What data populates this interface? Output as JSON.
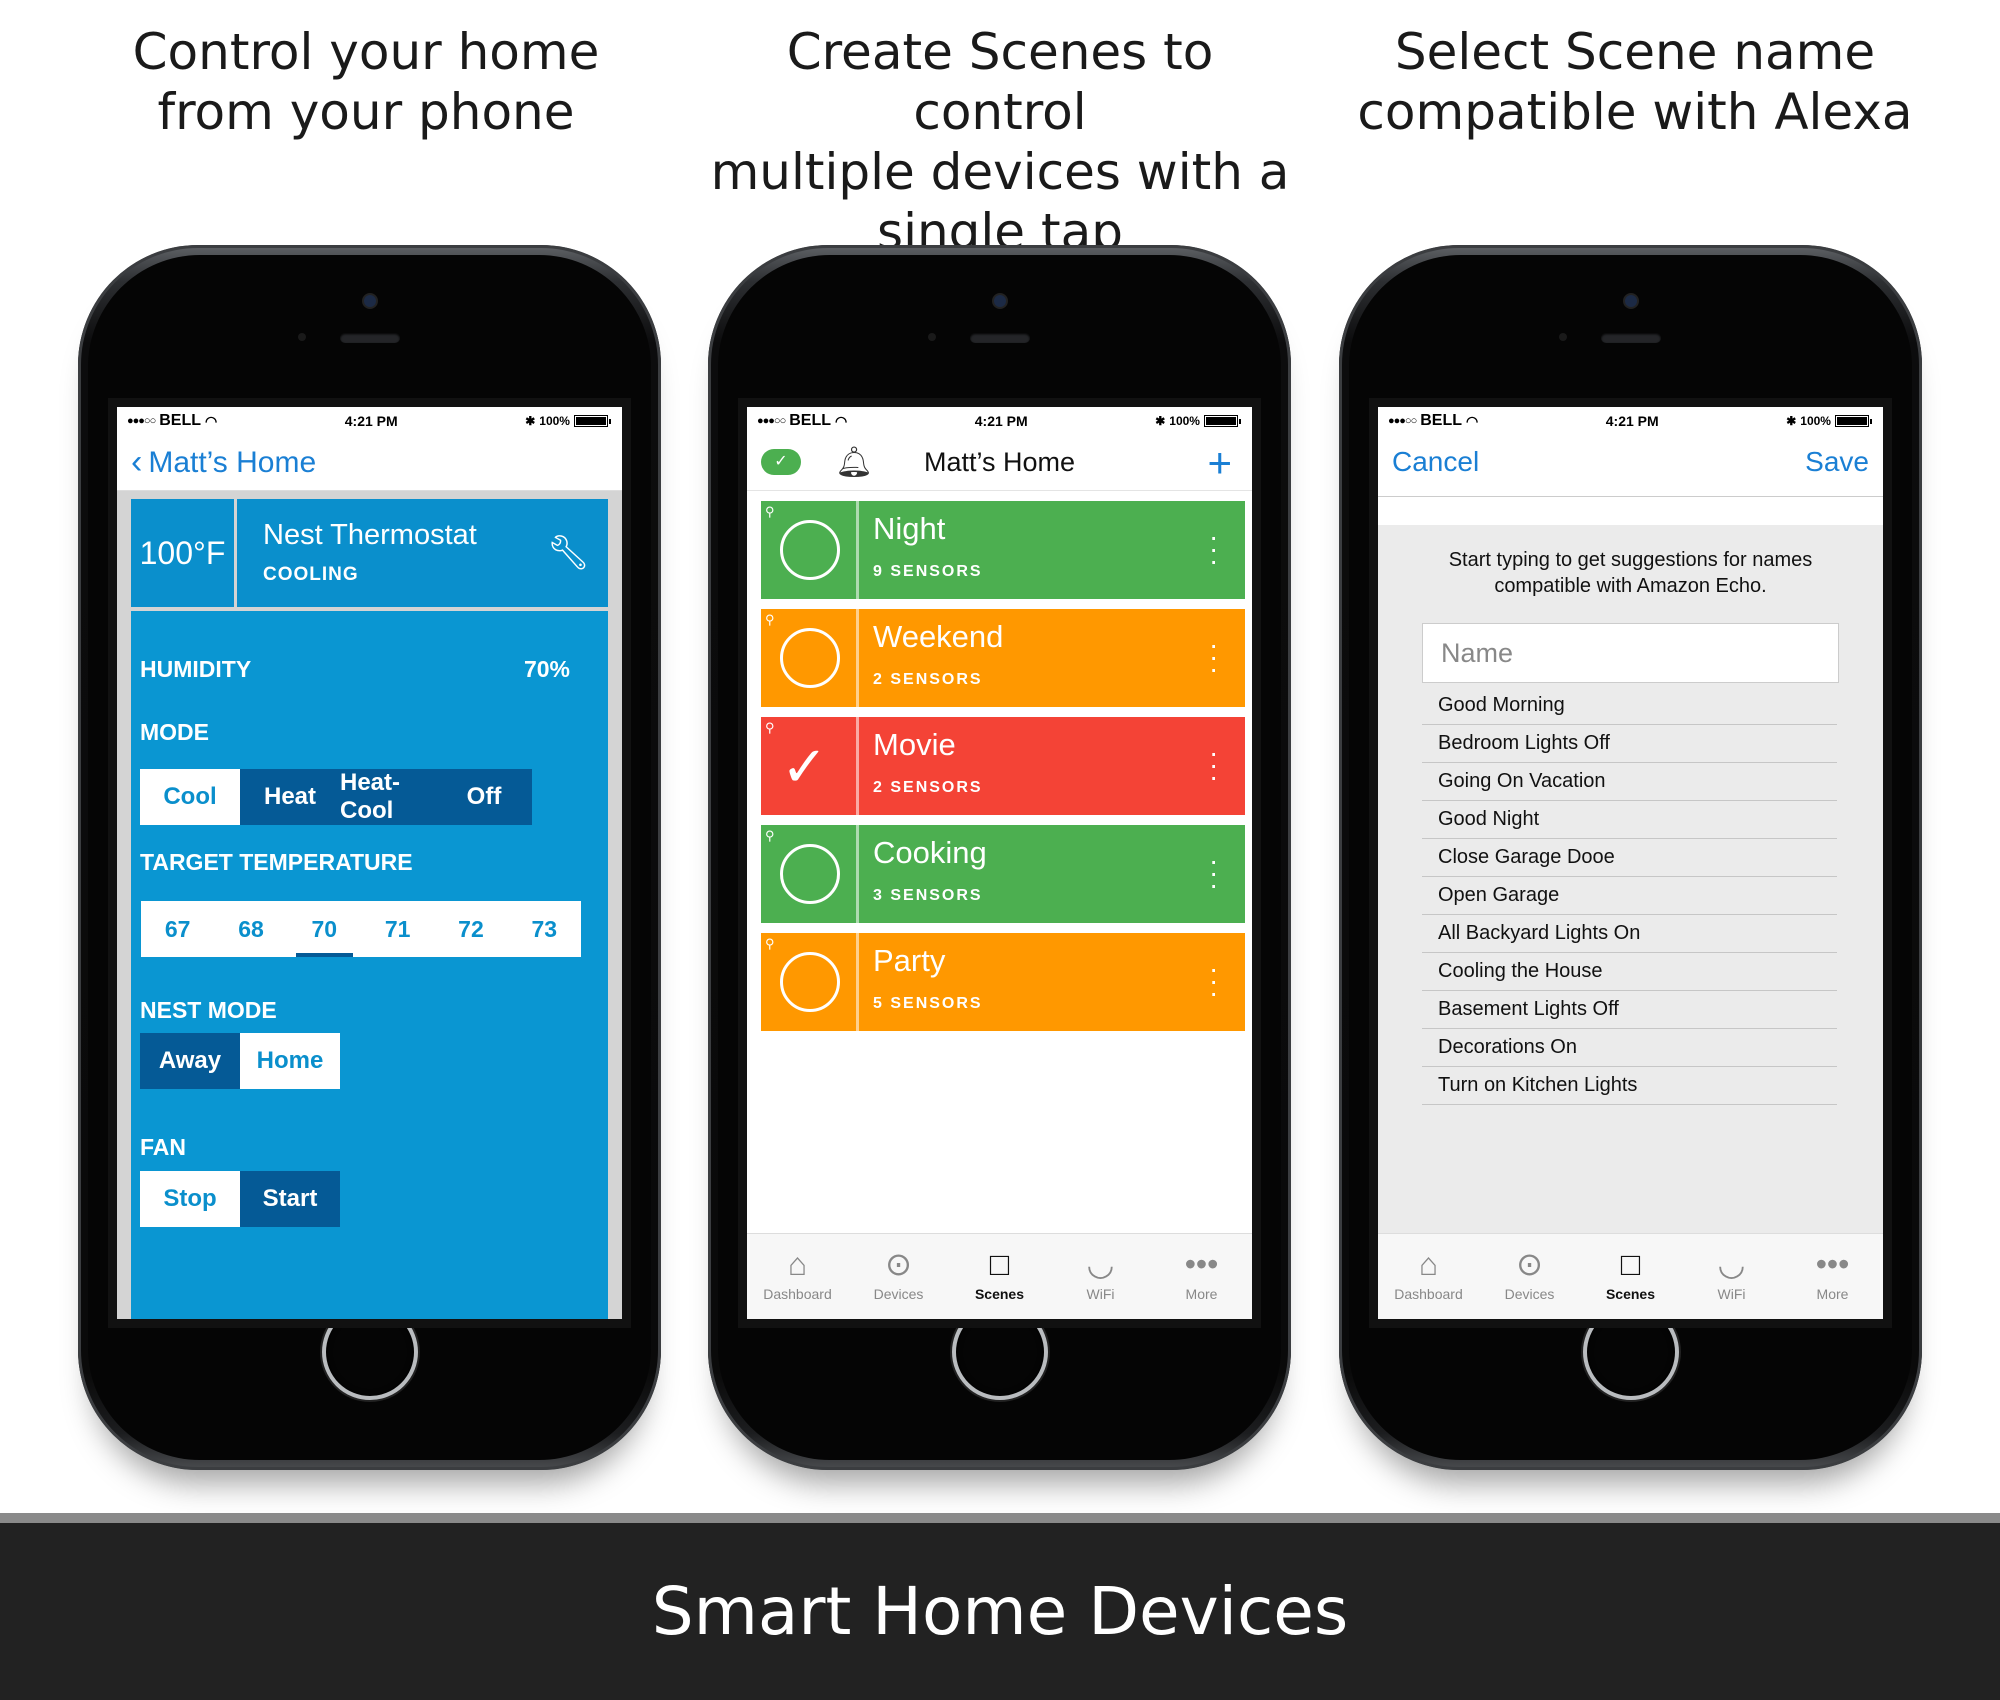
{
  "captions": [
    {
      "lines": [
        "Control your home",
        "from your phone"
      ]
    },
    {
      "lines": [
        "Create Scenes to control",
        "multiple devices with a",
        "single tap"
      ]
    },
    {
      "lines": [
        "Select Scene name",
        "compatible with Alexa"
      ]
    }
  ],
  "status": {
    "carrier": "BELL",
    "time": "4:21 PM",
    "battery": "100%"
  },
  "phone1": {
    "back_label": "Matt’s Home",
    "temperature": "100°F",
    "device_name": "Nest Thermostat",
    "device_state": "COOLING",
    "humidity_label": "HUMIDITY",
    "humidity_value": "70%",
    "mode_label": "MODE",
    "modes": [
      "Cool",
      "Heat",
      "Heat-Cool",
      "Off"
    ],
    "target_label": "TARGET TEMPERATURE",
    "targets": [
      "67",
      "68",
      "70",
      "71",
      "72",
      "73"
    ],
    "nest_mode_label": "NEST MODE",
    "nest_modes": [
      "Away",
      "Home"
    ],
    "fan_label": "FAN",
    "fan_modes": [
      "Stop",
      "Start"
    ]
  },
  "phone2": {
    "title": "Matt’s Home",
    "scenes": [
      {
        "name": "Night",
        "sensors": "9 SENSORS",
        "color": "#4caf50"
      },
      {
        "name": "Weekend",
        "sensors": "2 SENSORS",
        "color": "#ff9800"
      },
      {
        "name": "Movie",
        "sensors": "2 SENSORS",
        "color": "#f44336"
      },
      {
        "name": "Cooking",
        "sensors": "3 SENSORS",
        "color": "#4caf50"
      },
      {
        "name": "Party",
        "sensors": "5 SENSORS",
        "color": "#ff9800"
      }
    ]
  },
  "tabs": [
    "Dashboard",
    "Devices",
    "Scenes",
    "WiFi",
    "More"
  ],
  "phone3": {
    "cancel": "Cancel",
    "save": "Save",
    "hint_line1": "Start typing to get suggestions for names",
    "hint_line2": "compatible with Amazon Echo.",
    "name_placeholder": "Name",
    "suggestions": [
      "Good Morning",
      "Bedroom Lights Off",
      "Going On Vacation",
      "Good Night",
      "Close Garage Dooe",
      "Open Garage",
      "All Backyard Lights On",
      "Cooling the House",
      "Basement Lights Off",
      "Decorations On",
      "Turn on Kitchen Lights"
    ]
  },
  "footer_title": "Smart Home Devices"
}
